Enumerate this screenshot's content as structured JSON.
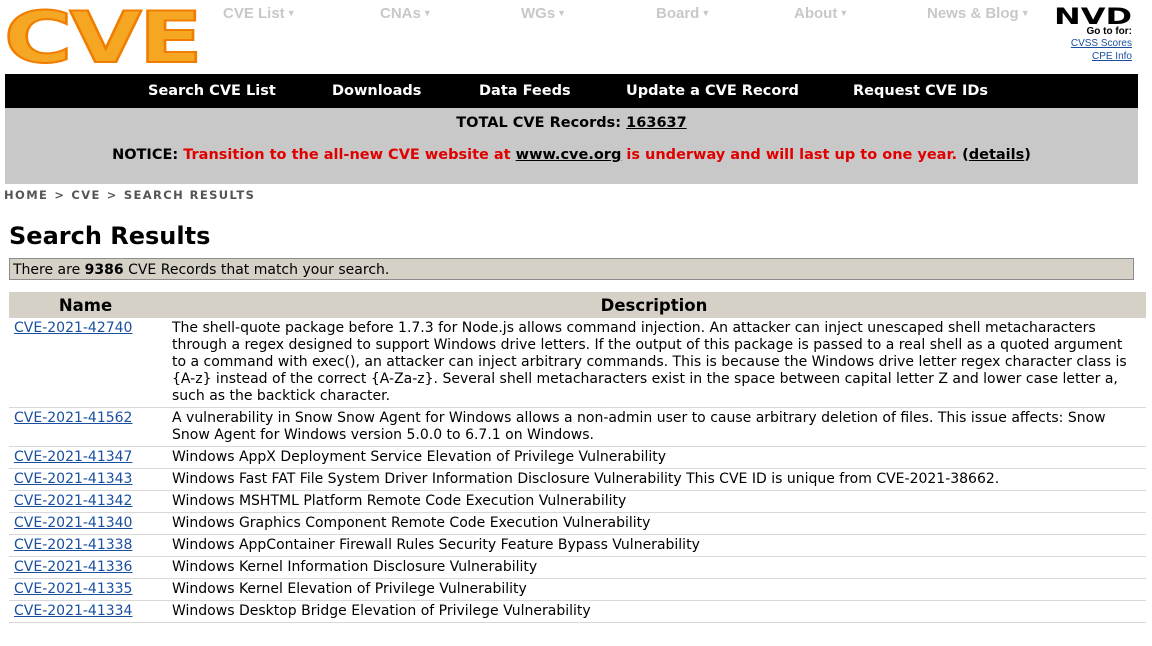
{
  "logo": {
    "text": "CVE",
    "colors": {
      "fill": "#f5a623",
      "stroke": "#f07d00"
    }
  },
  "topnav": [
    {
      "label": "CVE List"
    },
    {
      "label": "CNAs"
    },
    {
      "label": "WGs"
    },
    {
      "label": "Board"
    },
    {
      "label": "About"
    },
    {
      "label": "News & Blog"
    }
  ],
  "nvd": {
    "logo_text": "NVD",
    "goto_label": "Go to for:",
    "links": [
      "CVSS Scores",
      "CPE Info"
    ]
  },
  "mainnav": [
    "Search CVE List",
    "Downloads",
    "Data Feeds",
    "Update a CVE Record",
    "Request CVE IDs"
  ],
  "banner": {
    "total_label": "TOTAL CVE Records:",
    "total_value": "163637",
    "notice_label": "NOTICE:",
    "notice_text_1": "Transition to the all-new CVE website at",
    "notice_link": "www.cve.org",
    "notice_text_2": "is underway and will last up to one year.",
    "details_link": "details"
  },
  "breadcrumb": [
    "HOME",
    "CVE",
    "SEARCH RESULTS"
  ],
  "page_title": "Search Results",
  "match": {
    "prefix": "There are",
    "count": "9386",
    "suffix": "CVE Records that match your search."
  },
  "table": {
    "headers": [
      "Name",
      "Description"
    ],
    "rows": [
      {
        "name": "CVE-2021-42740",
        "description": "The shell-quote package before 1.7.3 for Node.js allows command injection. An attacker can inject unescaped shell metacharacters through a regex designed to support Windows drive letters. If the output of this package is passed to a real shell as a quoted argument to a command with exec(), an attacker can inject arbitrary commands. This is because the Windows drive letter regex character class is {A-z} instead of the correct {A-Za-z}. Several shell metacharacters exist in the space between capital letter Z and lower case letter a, such as the backtick character."
      },
      {
        "name": "CVE-2021-41562",
        "description": "A vulnerability in Snow Snow Agent for Windows allows a non-admin user to cause arbitrary deletion of files. This issue affects: Snow Snow Agent for Windows version 5.0.0 to 6.7.1 on Windows."
      },
      {
        "name": "CVE-2021-41347",
        "description": "Windows AppX Deployment Service Elevation of Privilege Vulnerability"
      },
      {
        "name": "CVE-2021-41343",
        "description": "Windows Fast FAT File System Driver Information Disclosure Vulnerability This CVE ID is unique from CVE-2021-38662."
      },
      {
        "name": "CVE-2021-41342",
        "description": "Windows MSHTML Platform Remote Code Execution Vulnerability"
      },
      {
        "name": "CVE-2021-41340",
        "description": "Windows Graphics Component Remote Code Execution Vulnerability"
      },
      {
        "name": "CVE-2021-41338",
        "description": "Windows AppContainer Firewall Rules Security Feature Bypass Vulnerability"
      },
      {
        "name": "CVE-2021-41336",
        "description": "Windows Kernel Information Disclosure Vulnerability"
      },
      {
        "name": "CVE-2021-41335",
        "description": "Windows Kernel Elevation of Privilege Vulnerability"
      },
      {
        "name": "CVE-2021-41334",
        "description": "Windows Desktop Bridge Elevation of Privilege Vulnerability"
      }
    ]
  }
}
